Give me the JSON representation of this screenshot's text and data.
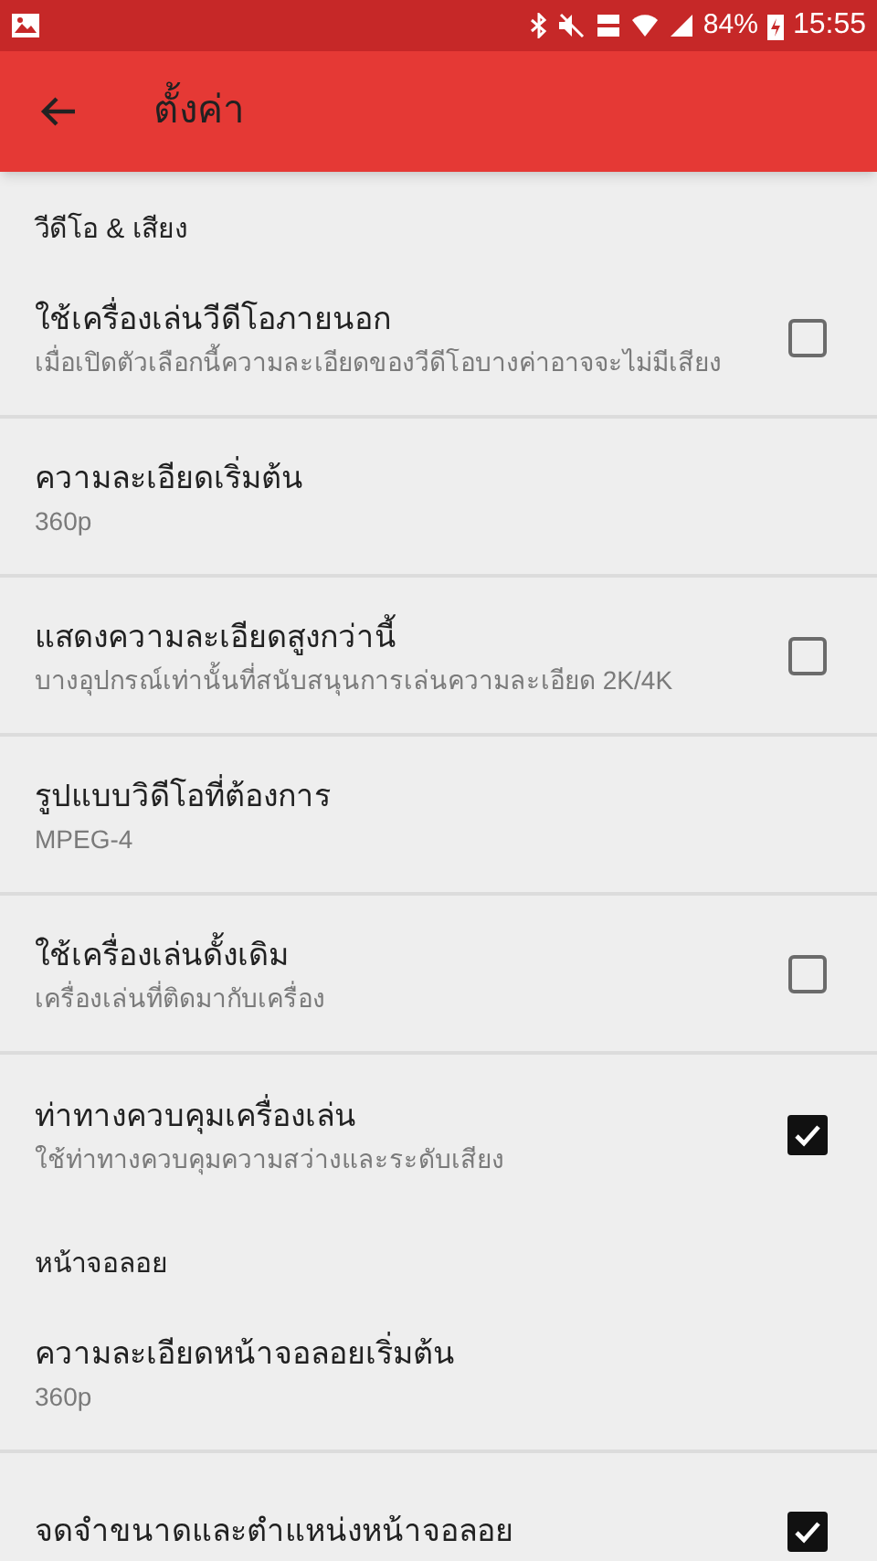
{
  "status_bar": {
    "battery": "84%",
    "time": "15:55"
  },
  "app_bar": {
    "title": "ตั้งค่า"
  },
  "sections": [
    {
      "header": "วีดีโอ & เสียง",
      "items": [
        {
          "kind": "checkbox",
          "title": "ใช้เครื่องเล่นวีดีโอภายนอก",
          "subtitle": "เมื่อเปิดตัวเลือกนี้ความละเอียดของวีดีโอบางค่าอาจจะไม่มีเสียง",
          "checked": false
        },
        {
          "kind": "value",
          "title": "ความละเอียดเริ่มต้น",
          "subtitle": "360p"
        },
        {
          "kind": "checkbox",
          "title": "แสดงความละเอียดสูงกว่านี้",
          "subtitle": "บางอุปกรณ์เท่านั้นที่สนับสนุนการเล่นความละเอียด 2K/4K",
          "checked": false
        },
        {
          "kind": "value",
          "title": "รูปแบบวิดีโอที่ต้องการ",
          "subtitle": "MPEG-4"
        },
        {
          "kind": "checkbox",
          "title": "ใช้เครื่องเล่นดั้งเดิม",
          "subtitle": "เครื่องเล่นที่ติดมากับเครื่อง",
          "checked": false
        },
        {
          "kind": "checkbox",
          "title": "ท่าทางควบคุมเครื่องเล่น",
          "subtitle": "ใช้ท่าทางควบคุมความสว่างและระดับเสียง",
          "checked": true
        }
      ]
    },
    {
      "header": "หน้าจอลอย",
      "items": [
        {
          "kind": "value",
          "title": "ความละเอียดหน้าจอลอยเริ่มต้น",
          "subtitle": "360p"
        },
        {
          "kind": "checkbox",
          "title": "จดจำขนาดและตำแหน่งหน้าจอลอย",
          "checked": true
        }
      ]
    }
  ]
}
